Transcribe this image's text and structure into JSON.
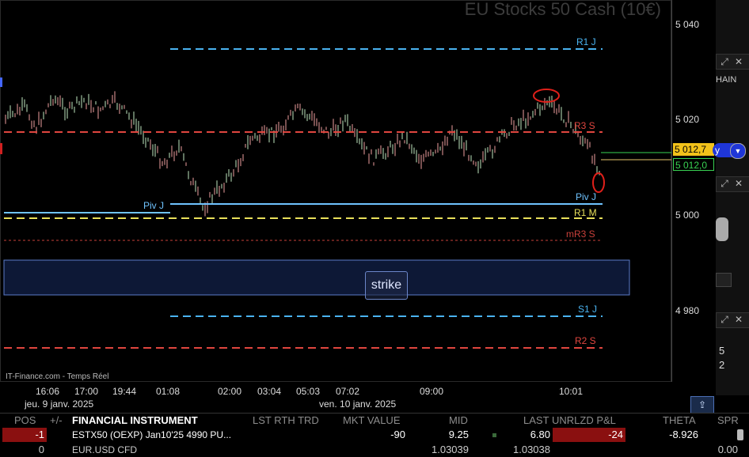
{
  "chart": {
    "title": "EU Stocks 50 Cash (10€)",
    "watermark": "IT-Finance.com - Temps Réel",
    "strike_label": "strike",
    "y_ticks": [
      "5 040",
      "5 020",
      "5 000",
      "4 980"
    ],
    "last_price_marker": "5 012,7",
    "mid_price_marker": "5 012,0",
    "x_ticks": [
      "16:06",
      "17:00",
      "19:44",
      "01:08",
      "02:00",
      "03:04",
      "05:03",
      "07:02",
      "09:00",
      "10:01"
    ],
    "x_dates": [
      "jeu. 9 janv. 2025",
      "ven. 10 janv. 2025"
    ],
    "levels": {
      "r1j": "R1 J",
      "r3s": "R3 S",
      "pivj_left": "Piv J",
      "pivj_right": "Piv J",
      "r1m": "R1 M",
      "mr3s": "mR3 S",
      "s1j": "S1 J",
      "r2s": "R2 S"
    },
    "colors": {
      "r1j": "#4ab3f0",
      "r3s": "#e0463f",
      "pivj": "#6fc3ff",
      "r1m": "#e8e05a",
      "mr3s": "#c9403a",
      "s1j": "#4ab3f0",
      "r2s": "#e0463f",
      "last_price_bg": "#f3c21a",
      "mid_price_fg": "#39d353"
    }
  },
  "right_strip": {
    "chain_label": "HAIN",
    "dropdown_letter": "y",
    "value_1": "5",
    "value_2": "2",
    "scroll_label": "⇪"
  },
  "portfolio": {
    "headers": {
      "pos": "POS",
      "plusminus": "+/-",
      "instrument": "FINANCIAL INSTRUMENT",
      "lst_rth_trd": "LST RTH TRD",
      "mkt_value": "MKT VALUE",
      "mid": "MID",
      "last": "LAST",
      "unrlzd_pl": "UNRLZD P&L",
      "theta": "THETA",
      "spr": "SPR"
    },
    "rows": [
      {
        "pos": "-1",
        "instrument": "ESTX50 (OEXP) Jan10'25 4990 PU...",
        "mkt_value": "-90",
        "mid": "9.25",
        "last": "6.80",
        "unrlzd_pl": "-24",
        "theta": "-8.926"
      },
      {
        "pos": "0",
        "instrument": "EUR.USD CFD",
        "mid": "1.03039",
        "last": "1.03038",
        "theta": "0.00"
      }
    ]
  }
}
